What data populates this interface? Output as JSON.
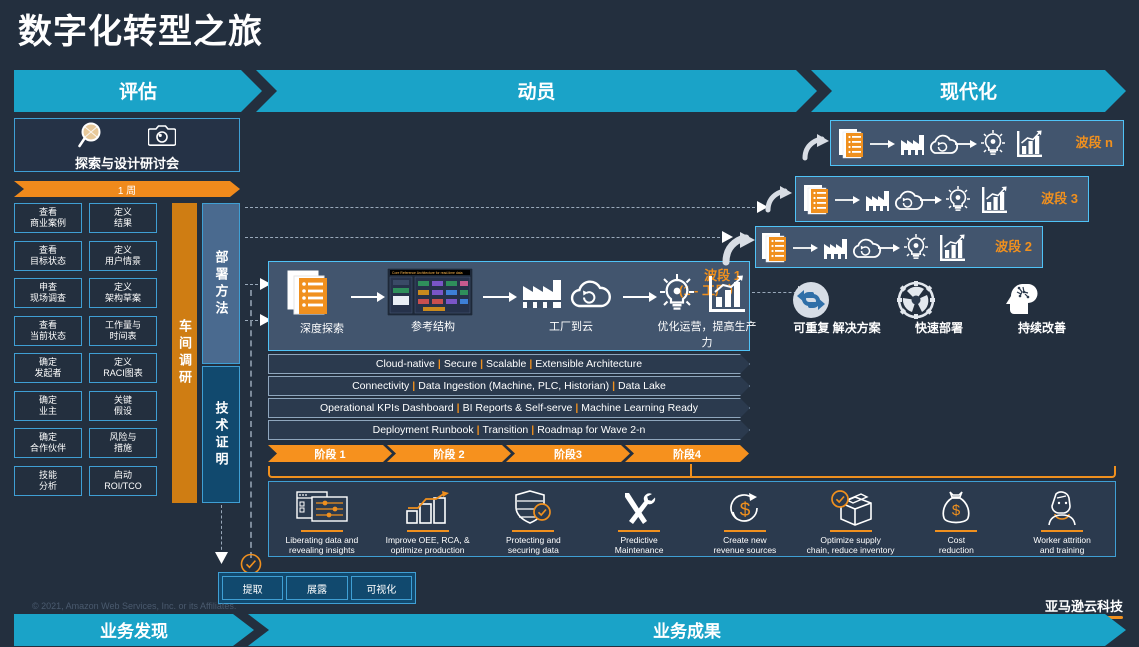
{
  "title": "数字化转型之旅",
  "phase_banner": {
    "items": [
      {
        "label": "评估"
      },
      {
        "label": "动员"
      },
      {
        "label": "现代化"
      }
    ]
  },
  "footer_banner": {
    "items": [
      {
        "label": "业务发现"
      },
      {
        "label": "业务成果"
      }
    ]
  },
  "workshop": {
    "label": "探索与设计研讨会",
    "icons": [
      "magnifier-icon",
      "camera-icon"
    ],
    "duration_ribbon": "1 周"
  },
  "assess_tasks": {
    "left": [
      "查看\n商业案例",
      "查看\n目标状态",
      "申查\n现场调查",
      "查看\n当前状态",
      "确定\n发起者",
      "确定\n业主",
      "确定\n合作伙伴",
      "技能\n分析"
    ],
    "right": [
      "定义\n结果",
      "定义\n用户情景",
      "定义\n架构草案",
      "工作量与\n时间表",
      "定义\nRACI图表",
      "关键\n假设",
      "风险与\n措施",
      "启动\nROI/TCO"
    ]
  },
  "vertical_bars": {
    "workshop_survey": "车间调研",
    "deploy_method": "部署方法",
    "tech_proof": "技术证明"
  },
  "wave1": {
    "tag_line1": "波段 1",
    "tag_line2": "(1 - 工厂）",
    "steps": [
      {
        "icon": "document-list-icon",
        "caption": "深度探索"
      },
      {
        "icon": "reference-architecture-thumbnail",
        "caption": "参考结构"
      },
      {
        "icon": "factory-cloud-icon",
        "caption": "工厂到云"
      },
      {
        "icon": "lightbulb-chart-icon",
        "caption": "优化运营，提高生产力"
      }
    ]
  },
  "other_waves": [
    {
      "tag": "波段 n",
      "has_curved_arrow": true
    },
    {
      "tag": "波段 3",
      "has_curved_arrow": true
    },
    {
      "tag": "波段 2",
      "has_curved_arrow": true
    }
  ],
  "architecture_bars": [
    [
      "Cloud-native",
      "Secure",
      "Scalable",
      "Extensible Architecture"
    ],
    [
      "Connectivity",
      "Data Ingestion (Machine, PLC, Historian)",
      "Data Lake"
    ],
    [
      "Operational KPIs Dashboard",
      "BI Reports & Self-serve",
      "Machine Learning Ready"
    ],
    [
      "Deployment Runbook",
      "Transition",
      "Roadmap for Wave 2-n"
    ]
  ],
  "phases": [
    "阶段 1",
    "阶段 2",
    "阶段3",
    "阶段4"
  ],
  "outcomes": [
    {
      "icon": "dashboard-sliders-icon",
      "text": "Liberating data and\nrevealing insights"
    },
    {
      "icon": "bar-chart-trend-icon",
      "text": "Improve OEE, RCA, &\noptimize production"
    },
    {
      "icon": "shield-check-icon",
      "text": "Protecting and\nsecuring data"
    },
    {
      "icon": "wrench-screwdriver-icon",
      "text": "Predictive\nMaintenance"
    },
    {
      "icon": "dollar-cycle-icon",
      "text": "Create new\nrevenue sources"
    },
    {
      "icon": "box-check-icon",
      "text": "Optimize supply\nchain, reduce inventory"
    },
    {
      "icon": "money-bag-icon",
      "text": "Cost\nreduction"
    },
    {
      "icon": "worker-head-icon",
      "text": "Worker attrition\nand training"
    }
  ],
  "benefits": [
    {
      "icon": "recycle-arrows-icon",
      "text": "可重复\n解决方案"
    },
    {
      "icon": "gear-fan-icon",
      "text": "快速部署"
    },
    {
      "icon": "brain-head-icon",
      "text": "持续改善"
    }
  ],
  "bottom_boxes": [
    "提取",
    "展露",
    "可视化"
  ],
  "copyright": "© 2021, Amazon Web Services, Inc. or its Affiliates.",
  "aws_logo_text": "亚马逊云科技",
  "colors": {
    "background": "#232f3e",
    "banner": "#1aa3c8",
    "accent_orange": "#f0901e",
    "border_blue": "#3f9fd4",
    "wave_panel": "#42556e"
  }
}
